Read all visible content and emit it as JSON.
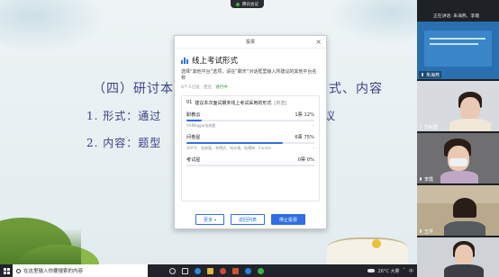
{
  "meeting": {
    "status_text": "腾讯会议"
  },
  "slide": {
    "title_left": "（四）研讨本",
    "title_right": "式、内容",
    "line1_left": "1. 形式：通过",
    "line1_right": "议",
    "line2_left": "2. 内容：题型"
  },
  "poll": {
    "header": "投票",
    "title": "线上考试形式",
    "description": "选择“其他平台”选项，请在“聊天”对话框里输入所建议的其他平台名称",
    "meta_participants": "8个人已投 · 匿名",
    "meta_status": "进行中",
    "question_no": "01",
    "question": "建议本次面试期末线上考试采用的形式",
    "question_type": "[单选]",
    "options": [
      {
        "label": "职教云",
        "count": "1票 12%",
        "percent": 12,
        "voters": "AAMeggie张海霞"
      },
      {
        "label": "问卷星",
        "count": "6票 75%",
        "percent": 75,
        "voters": "刘平平、张寂寞、李德武、钱水镇、陆曦婷、Connie"
      },
      {
        "label": "考试星",
        "count": "0票 0%",
        "percent": 0,
        "voters": ""
      }
    ],
    "btn_more": "更多",
    "btn_back": "返回列表",
    "btn_stop": "停止投票"
  },
  "panel": {
    "speaker": "正在讲话: 朱海燕、李霞",
    "tiles": [
      {
        "name": "朱海燕"
      },
      {
        "name": "司秋霞"
      },
      {
        "name": "李霞"
      },
      {
        "name": "王芹"
      }
    ]
  },
  "taskbar": {
    "search_placeholder": "在这里输入你要搜索的内容",
    "weather": "26°C 大雾",
    "lang": "中"
  }
}
